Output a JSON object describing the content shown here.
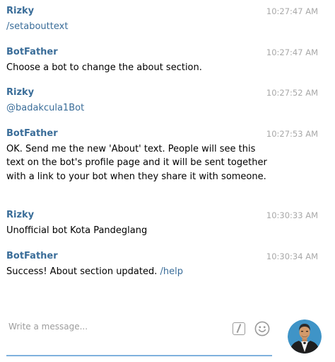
{
  "messages": [
    {
      "sender": "Rizky",
      "time": "10:27:47 AM",
      "text": "/setabouttext",
      "link": ""
    },
    {
      "sender": "BotFather",
      "time": "10:27:47 AM",
      "text": "Choose a bot to change the about section.",
      "link": ""
    },
    {
      "sender": "Rizky",
      "time": "10:27:52 AM",
      "text": "@badakcula1Bot",
      "link": ""
    },
    {
      "sender": "BotFather",
      "time": "10:27:53 AM",
      "text": "OK. Send me the new 'About' text. People will see this text on the bot's profile page and it will be sent together with a link to your bot when they share it with someone.",
      "link": ""
    },
    {
      "sender": "Rizky",
      "time": "10:30:33 AM",
      "text": "Unofficial bot Kota Pandeglang",
      "link": ""
    },
    {
      "sender": "BotFather",
      "time": "10:30:34 AM",
      "text": "Success! About section updated. ",
      "link": "/help"
    }
  ],
  "composer": {
    "placeholder": "Write a message...",
    "icons": [
      "bot-command-icon",
      "emoji-icon"
    ],
    "accent_color": "#7fb1dd"
  },
  "colors": {
    "sender_name": "#3a6d99",
    "timestamp": "#a8a8a8",
    "link": "#3a6d99"
  }
}
